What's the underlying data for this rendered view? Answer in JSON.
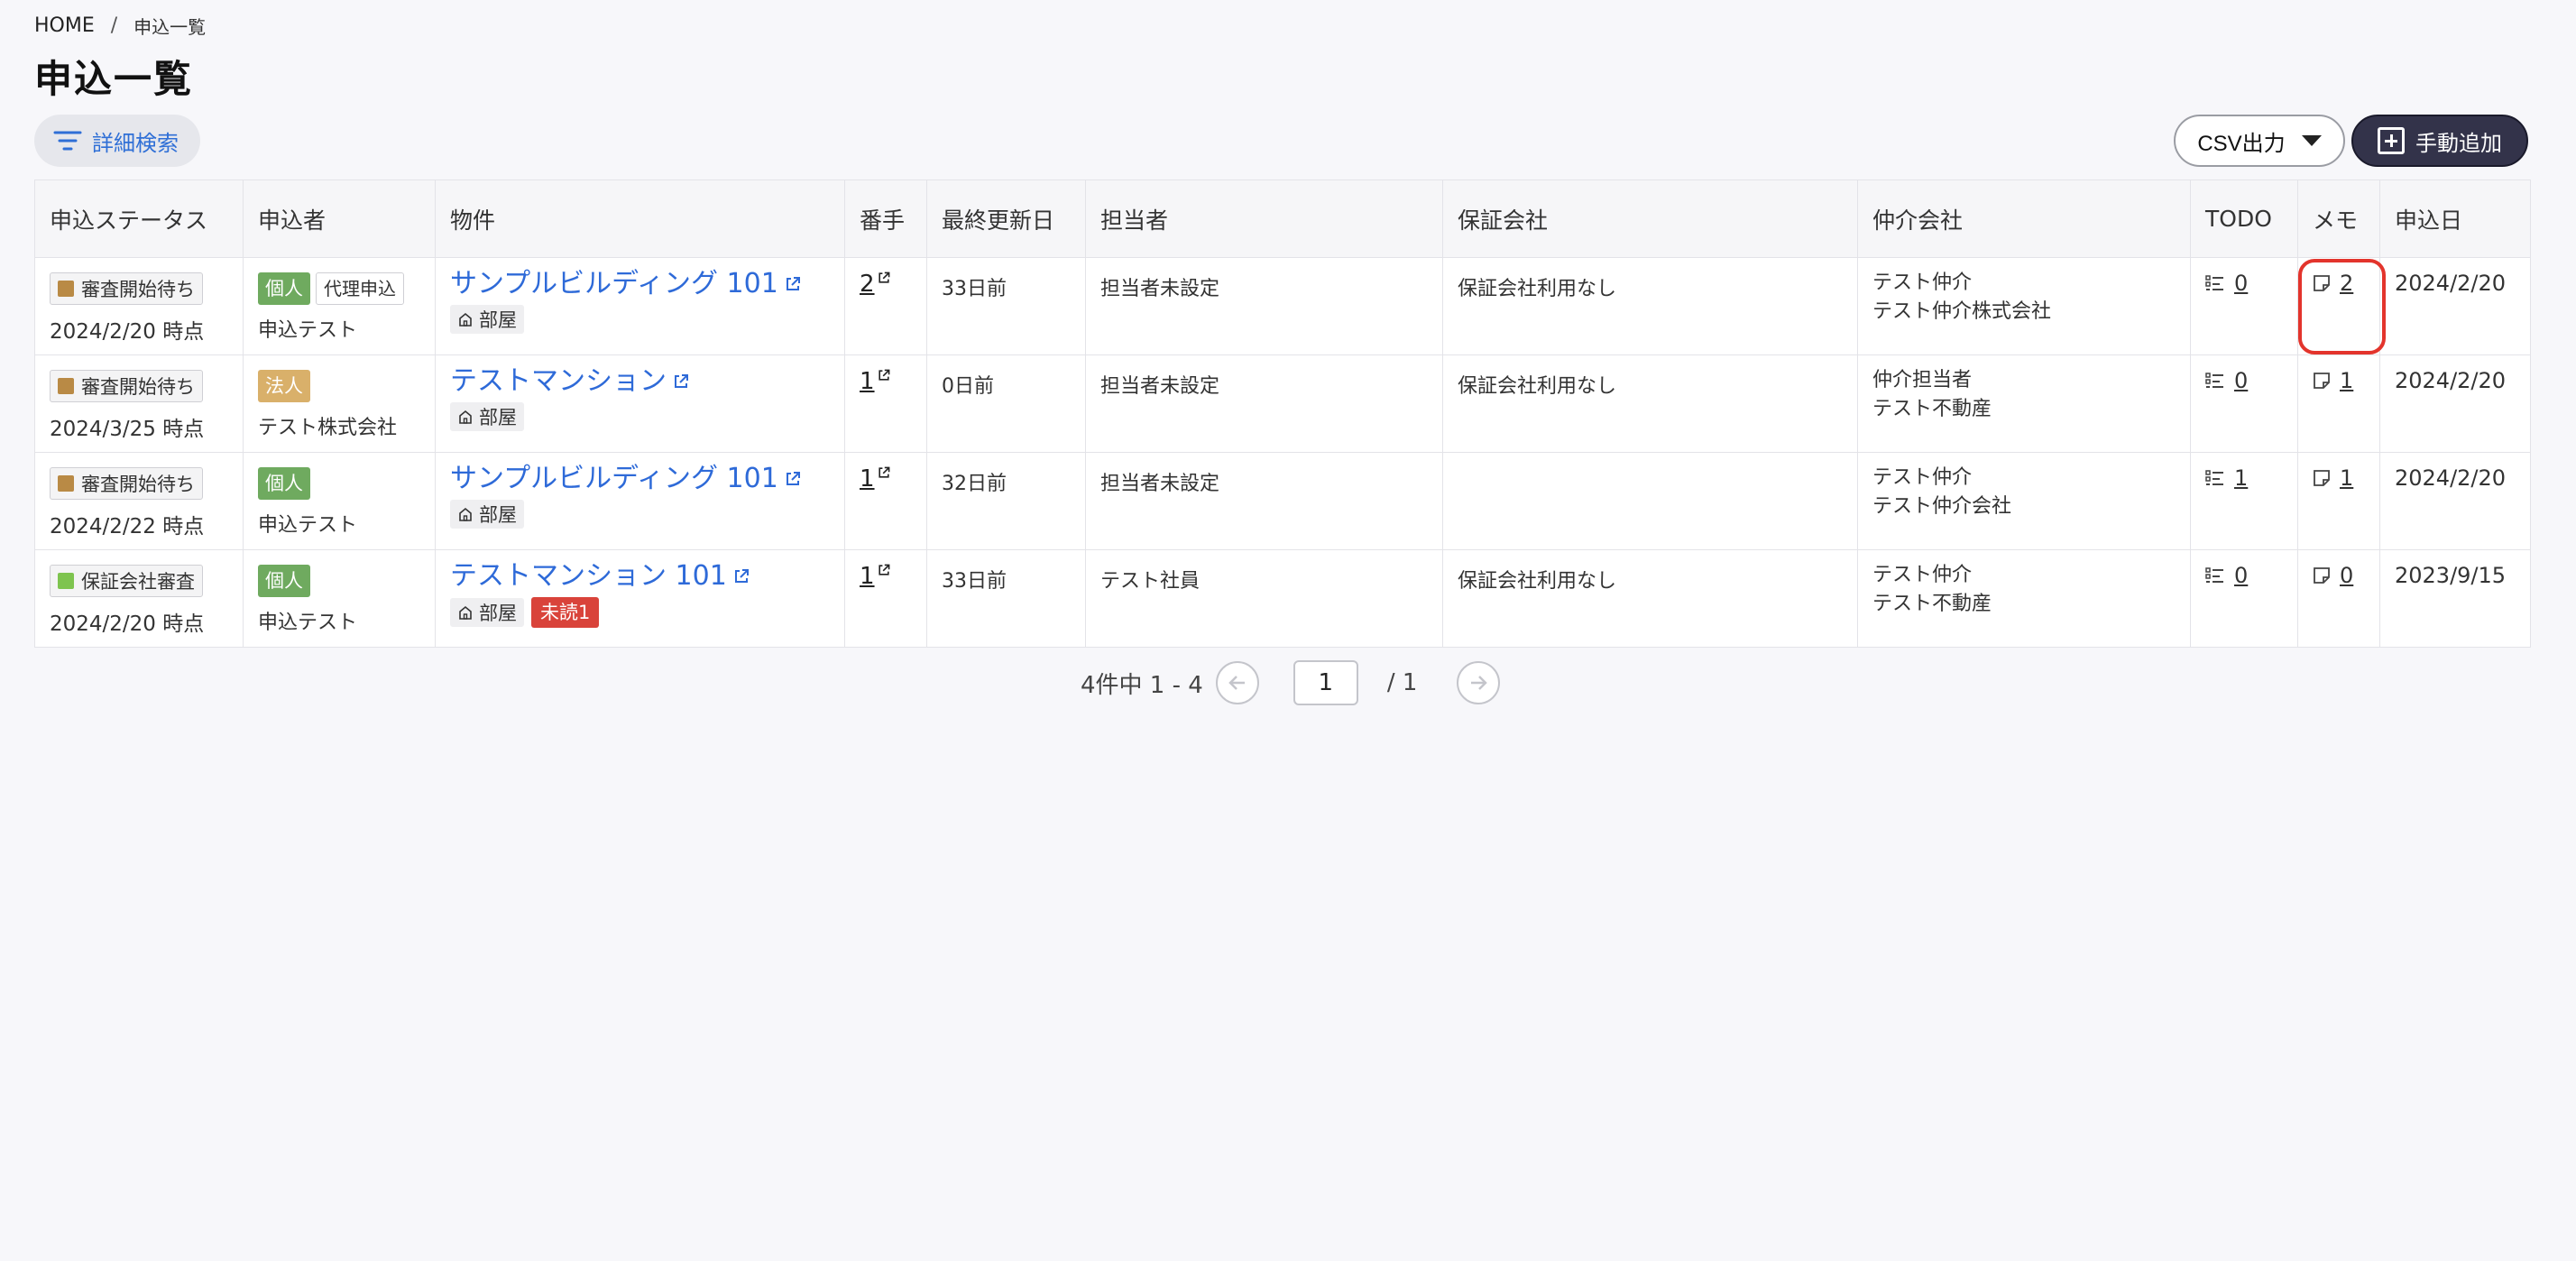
{
  "breadcrumb": {
    "home": "HOME",
    "sep": "/",
    "current": "申込一覧"
  },
  "page_title": "申込一覧",
  "toolbar": {
    "search_label": "詳細検索",
    "csv_label": "CSV出力",
    "add_label": "手動追加"
  },
  "columns": [
    "申込ステータス",
    "申込者",
    "物件",
    "番手",
    "最終更新日",
    "担当者",
    "保証会社",
    "仲介会社",
    "TODO",
    "メモ",
    "申込日"
  ],
  "rows": [
    {
      "status": "審査開始待ち",
      "status_color": "#b98a45",
      "status_date": "2024/2/20 時点",
      "type": "個人",
      "type_color": "#6faa5f",
      "proxy": "代理申込",
      "applicant": "申込テスト",
      "property": "サンプルビルディング 101",
      "room": "部屋",
      "unread": "",
      "order": "2",
      "updated": "33日前",
      "staff": "担当者未設定",
      "guarantor": "保証会社利用なし",
      "broker1": "テスト仲介",
      "broker2": "テスト仲介株式会社",
      "todo": "0",
      "memo": "2",
      "date": "2024/2/20"
    },
    {
      "status": "審査開始待ち",
      "status_color": "#b98a45",
      "status_date": "2024/3/25 時点",
      "type": "法人",
      "type_color": "#d9b06a",
      "proxy": "",
      "applicant": "テスト株式会社",
      "property": "テストマンション",
      "room": "部屋",
      "unread": "",
      "order": "1",
      "updated": "0日前",
      "staff": "担当者未設定",
      "guarantor": "保証会社利用なし",
      "broker1": "仲介担当者",
      "broker2": "テスト不動産",
      "todo": "0",
      "memo": "1",
      "date": "2024/2/20"
    },
    {
      "status": "審査開始待ち",
      "status_color": "#b98a45",
      "status_date": "2024/2/22 時点",
      "type": "個人",
      "type_color": "#6faa5f",
      "proxy": "",
      "applicant": "申込テスト",
      "property": "サンプルビルディング 101",
      "room": "部屋",
      "unread": "",
      "order": "1",
      "updated": "32日前",
      "staff": "担当者未設定",
      "guarantor": "",
      "broker1": "テスト仲介",
      "broker2": "テスト仲介会社",
      "todo": "1",
      "memo": "1",
      "date": "2024/2/20"
    },
    {
      "status": "保証会社審査",
      "status_color": "#7ec44f",
      "status_date": "2024/2/20 時点",
      "type": "個人",
      "type_color": "#6faa5f",
      "proxy": "",
      "applicant": "申込テスト",
      "property": "テストマンション 101",
      "room": "部屋",
      "unread": "未読1",
      "order": "1",
      "updated": "33日前",
      "staff": "テスト社員",
      "guarantor": "保証会社利用なし",
      "broker1": "テスト仲介",
      "broker2": "テスト不動産",
      "todo": "0",
      "memo": "0",
      "date": "2023/9/15"
    }
  ],
  "pagination": {
    "summary": "4件中 1 - 4",
    "current": "1",
    "total": "/ 1"
  }
}
